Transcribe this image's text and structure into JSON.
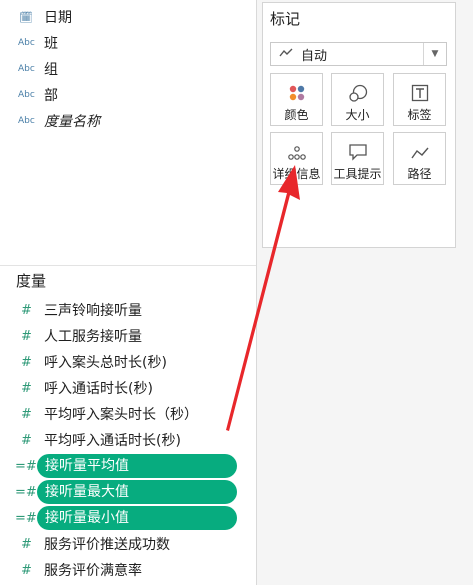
{
  "dimensions": [
    {
      "icon": "calendar-icon",
      "type_label": "",
      "label": "日期"
    },
    {
      "icon": "abc-icon",
      "type_label": "Abc",
      "label": "班"
    },
    {
      "icon": "abc-icon",
      "type_label": "Abc",
      "label": "组"
    },
    {
      "icon": "abc-icon",
      "type_label": "Abc",
      "label": "部"
    },
    {
      "icon": "abc-icon",
      "type_label": "Abc",
      "label": "度量名称"
    }
  ],
  "measures_title": "度量",
  "measures": [
    {
      "label": "三声铃响接听量"
    },
    {
      "label": "人工服务接听量"
    },
    {
      "label": "呼入案头总时长(秒)"
    },
    {
      "label": "呼入通话时长(秒)"
    },
    {
      "label": "平均呼入案头时长（秒）"
    },
    {
      "label": "平均呼入通话时长(秒)"
    },
    {
      "label": "接听量平均值"
    },
    {
      "label": "接听量最大值"
    },
    {
      "label": "接听量最小值"
    },
    {
      "label": "服务评价推送成功数"
    },
    {
      "label": "服务评价满意率"
    }
  ],
  "marks": {
    "title": "标记",
    "mark_type": "自动",
    "buttons": [
      "颜色",
      "大小",
      "标签",
      "详细信息",
      "工具提示",
      "路径"
    ]
  },
  "colors": {
    "pill": "#07ac7f",
    "measure_icon": "#2f9a78",
    "dimension_icon": "#4a7fa7",
    "arrow": "#e8272b"
  }
}
